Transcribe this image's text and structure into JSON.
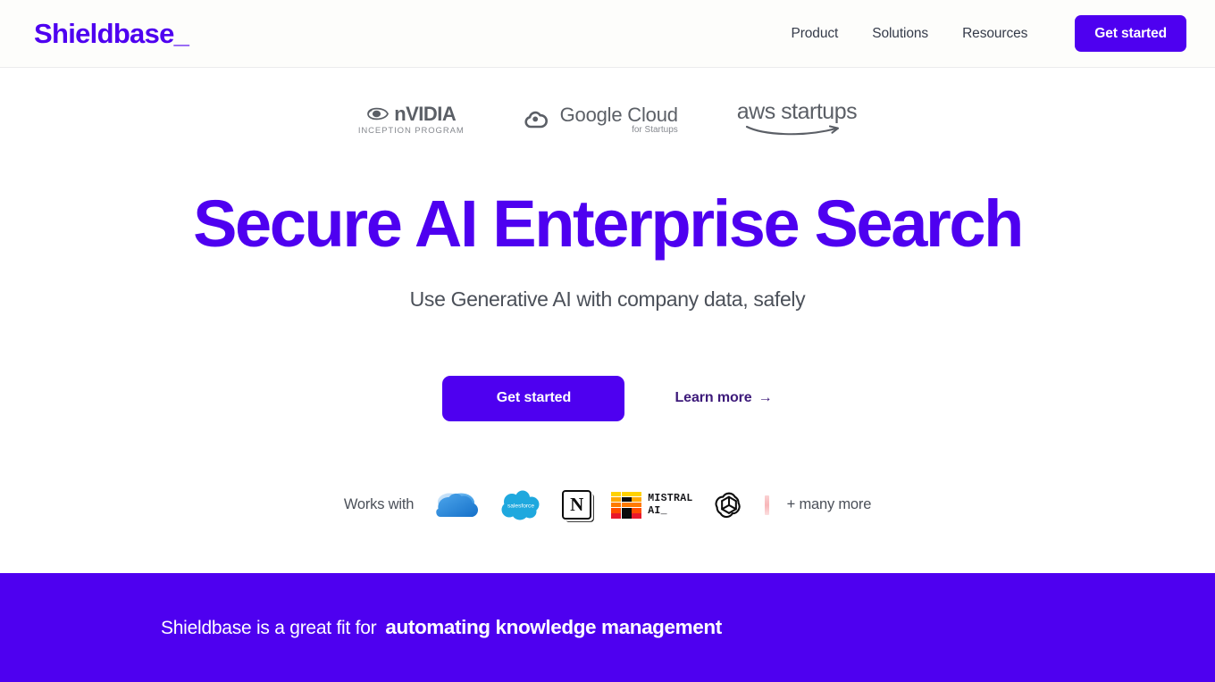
{
  "header": {
    "brand": "Shieldbase_",
    "nav": [
      {
        "label": "Product",
        "name": "nav-link-product"
      },
      {
        "label": "Solutions",
        "name": "nav-link-solutions"
      },
      {
        "label": "Resources",
        "name": "nav-link-resources"
      }
    ],
    "cta_label": "Get started"
  },
  "backers": [
    {
      "name": "nvidia-inception-program-logo",
      "word": "nVIDIA",
      "sub": "INCEPTION PROGRAM"
    },
    {
      "name": "google-cloud-for-startups-logo",
      "main": "Google Cloud",
      "sub": "for Startups"
    },
    {
      "name": "aws-startups-logo",
      "text": "aws startups"
    }
  ],
  "hero": {
    "headline": "Secure AI Enterprise Search",
    "subheadline": "Use Generative AI with company data, safely",
    "primary_cta": "Get started",
    "secondary_cta": "Learn more",
    "secondary_cta_arrow": "→"
  },
  "works_with": {
    "label": "Works with",
    "more_label": "+ many more",
    "integrations": [
      {
        "name": "onedrive-logo",
        "label": "OneDrive"
      },
      {
        "name": "salesforce-logo",
        "label": "salesforce"
      },
      {
        "name": "notion-logo",
        "label": "N"
      },
      {
        "name": "mistral-ai-logo",
        "line1": "MISTRAL",
        "line2": "AI_"
      },
      {
        "name": "openai-logo",
        "label": "OpenAI"
      }
    ]
  },
  "banner": {
    "prefix": "Shieldbase is a great fit for",
    "highlight": "automating knowledge management"
  },
  "colors": {
    "brand_purple": "#4e00f0",
    "banner_purple": "#4e00f0",
    "header_bg": "#fdfdfb",
    "body_text": "#353b4a",
    "muted_text": "#4b5059",
    "logo_gray": "#5b5f66"
  }
}
